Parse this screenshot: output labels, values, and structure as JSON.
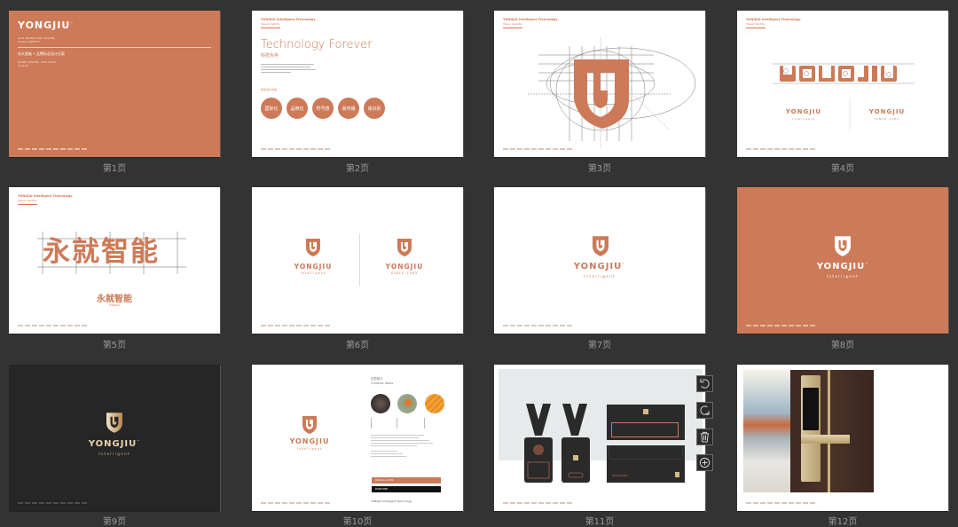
{
  "brand": {
    "wordmark": "YONGJIU",
    "tm": "™",
    "tagline": "Intelligent",
    "since": "SINCE 1985",
    "accent_color": "#cd7a58",
    "dark_color": "#262626",
    "cn_name": "永久智能"
  },
  "pages": [
    {
      "label": "第1页",
      "type": "cover",
      "lines": [
        "2021 BRAND LOGO DESIGN",
        "VISUAL IDENTITY"
      ],
      "title_cn": "永久智能 • 品牌标志设计方案",
      "meta": [
        "WANBY DESIGN · 2021/04/07",
        "2021/07"
      ]
    },
    {
      "label": "第2页",
      "type": "concept",
      "header": "YONGJIU Intelligent Technology",
      "headline": "Technology Forever",
      "headline_cn": "科技永存",
      "section": "标志设计方向",
      "pills": [
        "国际化",
        "品牌化",
        "符号感",
        "易传播",
        "易识别"
      ]
    },
    {
      "label": "第3页",
      "type": "construction",
      "header": "YONGJIU Intelligent Technology"
    },
    {
      "label": "第4页",
      "type": "wordmark-grid",
      "header": "YONGJIU Intelligent Technology"
    },
    {
      "label": "第5页",
      "type": "cn-grid",
      "header": "YONGJIU Intelligent Technology",
      "cn_big": "永就智能"
    },
    {
      "label": "第6页",
      "type": "logo-pair"
    },
    {
      "label": "第7页",
      "type": "logo-white"
    },
    {
      "label": "第8页",
      "type": "logo-orange"
    },
    {
      "label": "第9页",
      "type": "logo-dark"
    },
    {
      "label": "第10页",
      "type": "creative",
      "title": "创意释义",
      "subtitle": "Creative Ideas",
      "bar_orange": "Pantone 2021",
      "bar_dark": "PANTONE",
      "footer": "YONGJIU Intelligent Technology"
    },
    {
      "label": "第11页",
      "type": "stationery",
      "phone": "400-000-0000"
    },
    {
      "label": "第12页",
      "type": "photo"
    }
  ],
  "toolbar": [
    {
      "name": "rotate-left",
      "icon": "rotate-left-icon"
    },
    {
      "name": "rotate-right",
      "icon": "rotate-right-icon"
    },
    {
      "name": "delete",
      "icon": "trash-icon"
    },
    {
      "name": "add",
      "icon": "plus-circle-icon"
    }
  ]
}
